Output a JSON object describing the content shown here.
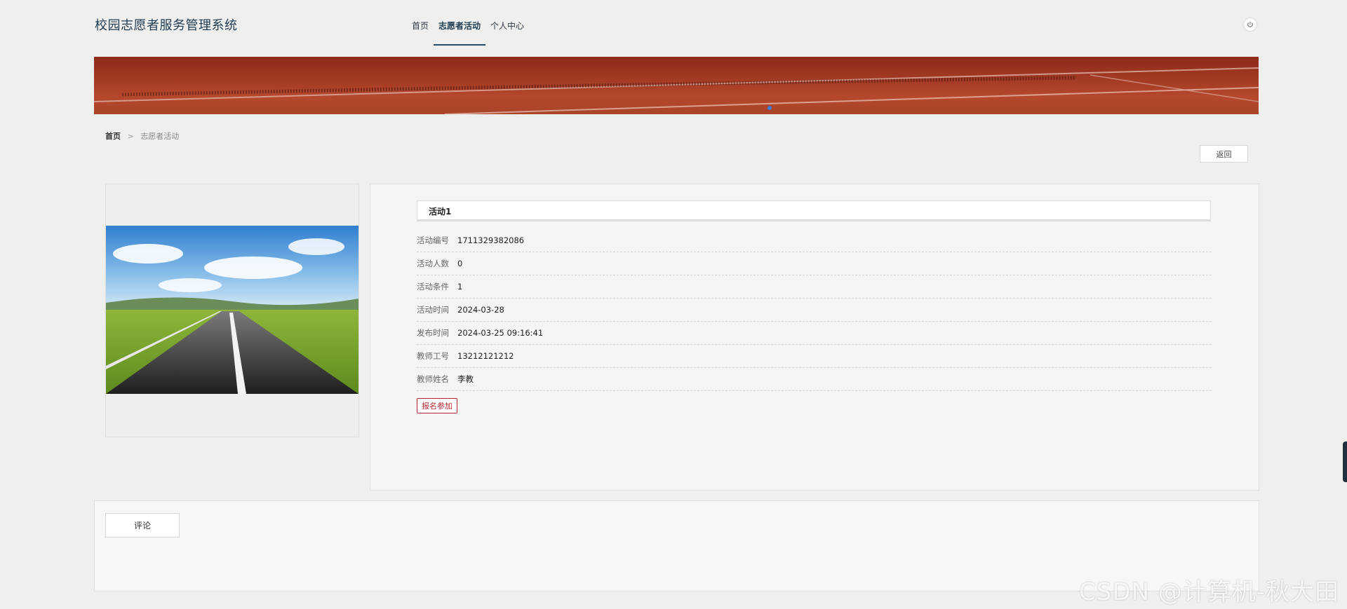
{
  "header": {
    "site_title": "校园志愿者服务管理系统",
    "nav": [
      {
        "label": "首页"
      },
      {
        "label": "志愿者活动"
      },
      {
        "label": "个人中心"
      }
    ]
  },
  "breadcrumb": {
    "home": "首页",
    "separator": ">",
    "current": "志愿者活动"
  },
  "back_button": "返回",
  "activity": {
    "title": "活动1",
    "fields": [
      {
        "label": "活动编号",
        "value": "1711329382086"
      },
      {
        "label": "活动人数",
        "value": "0"
      },
      {
        "label": "活动条件",
        "value": "1"
      },
      {
        "label": "活动时间",
        "value": "2024-03-28"
      },
      {
        "label": "发布时间",
        "value": "2024-03-25 09:16:41"
      },
      {
        "label": "教师工号",
        "value": "13212121212"
      },
      {
        "label": "教师姓名",
        "value": "李教"
      }
    ],
    "signup_button": "报名参加"
  },
  "comment_tab": "评论",
  "watermark": "CSDN @计算机-秋大田",
  "colors": {
    "accent": "#1f3b52",
    "signup": "#b3262e"
  }
}
